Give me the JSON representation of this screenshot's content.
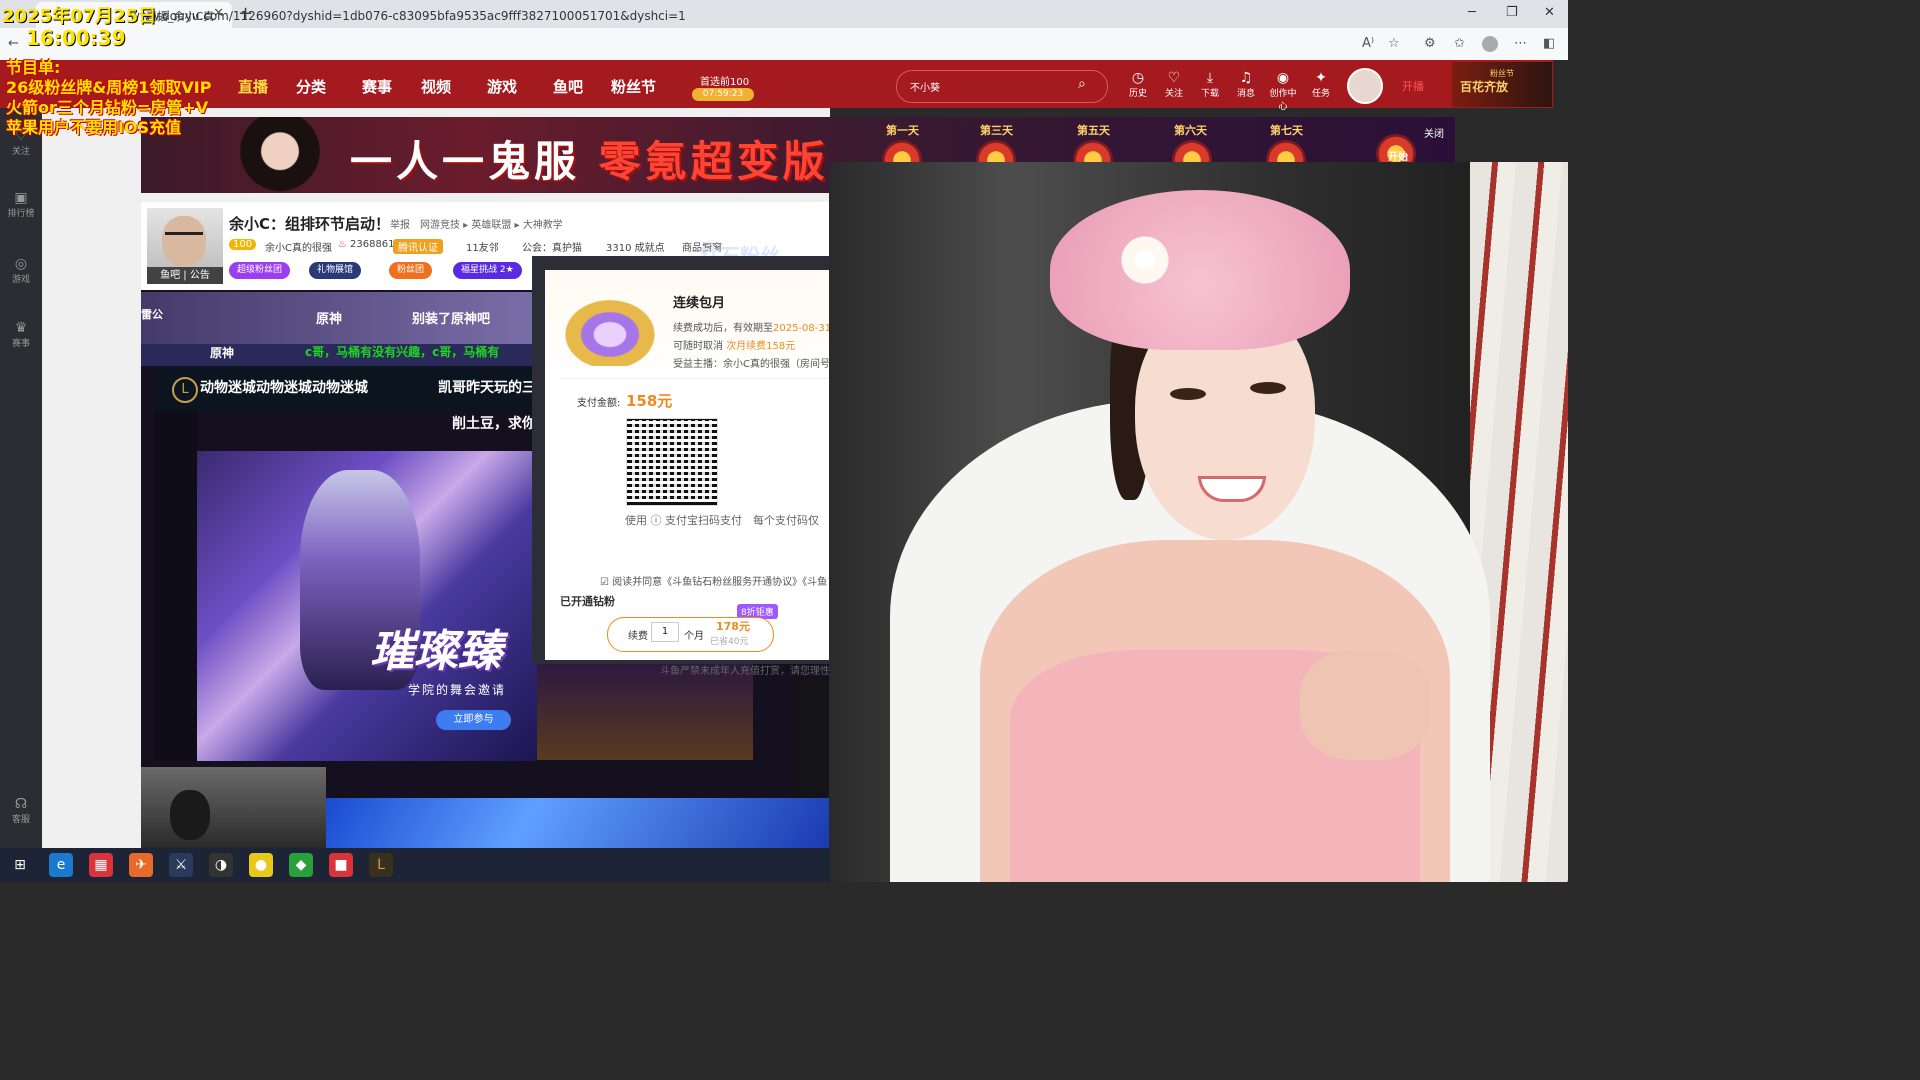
{
  "browser": {
    "tab_title": "直播_余小C真",
    "url": "www.douyu.com/1126960?dyshid=1db076-c83095bfa9535ac9fff3827100051701&dyshci=1",
    "new_tab": "+",
    "close": "✕"
  },
  "overlay": {
    "date": "2025年07月25日",
    "time": "16:00:39",
    "lines": [
      "节目单:",
      "26级粉丝牌&周榜1领取VIP",
      "火箭or三个月钻粉=房管+V",
      "苹果用户不要用IOS充值"
    ]
  },
  "header": {
    "nav": [
      "直播",
      "分类",
      "赛事",
      "视频",
      "游戏",
      "鱼吧",
      "粉丝节"
    ],
    "select_label": "首选前100",
    "select_timer": "07:59:23",
    "search_placeholder": "不小葵",
    "icons": [
      {
        "glyph": "◷",
        "label": "历史"
      },
      {
        "glyph": "♡",
        "label": "关注"
      },
      {
        "glyph": "⤓",
        "label": "下载"
      },
      {
        "glyph": "♫",
        "label": "消息"
      },
      {
        "glyph": "◉",
        "label": "创作中心"
      },
      {
        "glyph": "✦",
        "label": "任务"
      }
    ],
    "kaibo": "开播",
    "promo_sub": "粉丝节",
    "promo_title": "百花齐放"
  },
  "sidebar": [
    {
      "glyph": "♡",
      "label": "关注"
    },
    {
      "glyph": "▣",
      "label": "排行榜"
    },
    {
      "glyph": "◎",
      "label": "游戏"
    },
    {
      "glyph": "♛",
      "label": "赛事"
    },
    {
      "glyph": "☊",
      "label": "客服"
    }
  ],
  "banner": {
    "title_a": "一人一鬼服",
    "title_b": "零氪超变版",
    "days": [
      "第一天",
      "第三天",
      "第五天",
      "第六天",
      "第七天"
    ],
    "start": "开始",
    "close": "关闭"
  },
  "room": {
    "avatar_tag": "鱼吧 | 公告",
    "title": "余小C：组排环节启动！",
    "report": "举报",
    "category": "网游竞技 ▸ 英雄联盟 ▸ 大神教学",
    "level": "100",
    "name": "余小C真的很强",
    "hot": "2368861",
    "verify": "腾讯认证",
    "friends": "11友邻",
    "guild": "公会：真护猫",
    "achievements": "3310 成就点",
    "goods": "商品橱窗",
    "badges": [
      "超级粉丝团",
      "礼物展馆",
      "粉丝团",
      "福星挑战 2★"
    ],
    "diamond_banner": "钻石粉丝"
  },
  "game": {
    "tabs": [
      "雷公",
      "原神",
      "别装了原神吧"
    ],
    "row2": "原神",
    "danmu": "c哥，马桶有没有兴趣，c哥，马桶有",
    "lol_title": "动物迷城动物迷城动物迷城",
    "lol_name": "凯哥昨天玩的三",
    "lol_sub": "削土豆，求你",
    "splash_title": "璀璨臻",
    "splash_sub": "学院的舞会邀请",
    "splash_btn": "立即参与"
  },
  "modal": {
    "title": "连续包月",
    "line1_a": "续费成功后，有效期至",
    "line1_b": "2025-08-31",
    "line2_a": "可随时取消",
    "line2_b": "次月续费158元",
    "line3": "受益主播：余小C真的很强（房间号",
    "pay_label": "支付金额:",
    "pay_amount": "158元",
    "pay_hint": "使用 ⓘ 支付宝扫码支付　每个支付码仅",
    "agree": "☑ 阅读并同意《斗鱼钻石粉丝服务开通协议》《斗鱼",
    "under": "已开通钻粉",
    "renew_t1": "续费",
    "renew_n": "1",
    "renew_t2": "个月",
    "renew_price": "178元",
    "renew_saved": "已省40元",
    "discount": "8折钜惠",
    "minor_note": "斗鱼严禁未成年人充值打赏，请您理性"
  },
  "taskbar": [
    "⊞",
    "e",
    "▦",
    "✈",
    "⚔",
    "◑",
    "●",
    "◆",
    "■",
    "L"
  ]
}
